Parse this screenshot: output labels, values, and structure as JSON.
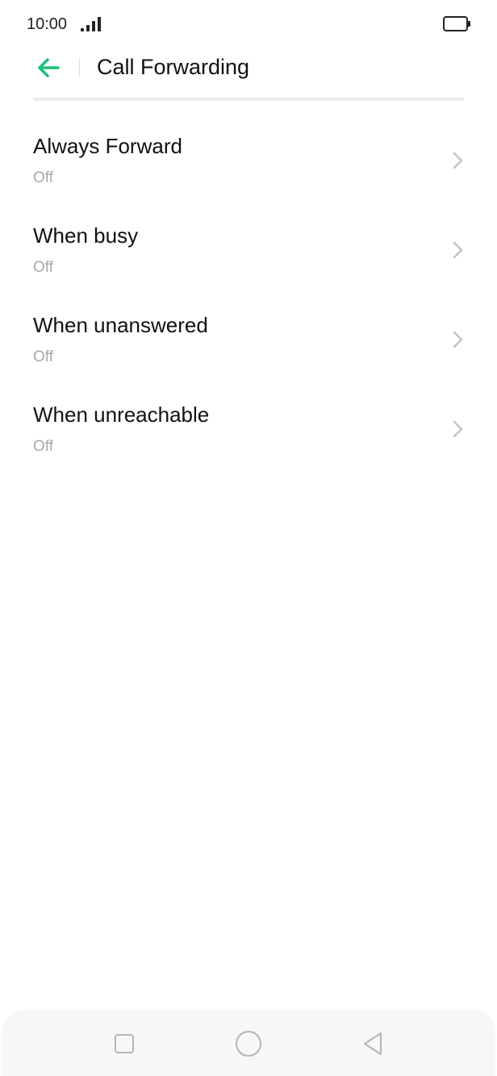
{
  "status_bar": {
    "time": "10:00",
    "signal_icon": "signal-bars-icon",
    "battery_icon": "battery-full-icon"
  },
  "header": {
    "back_icon": "arrow-left-icon",
    "title": "Call Forwarding"
  },
  "colors": {
    "accent": "#1fbf7a",
    "text_primary": "#111111",
    "text_secondary": "#a7a7a7",
    "nav_background": "#f7f7f7"
  },
  "items": [
    {
      "title": "Always Forward",
      "status": "Off"
    },
    {
      "title": "When busy",
      "status": "Off"
    },
    {
      "title": "When unanswered",
      "status": "Off"
    },
    {
      "title": "When unreachable",
      "status": "Off"
    }
  ],
  "nav_bar": {
    "recents_icon": "square-icon",
    "home_icon": "circle-icon",
    "back_icon": "triangle-back-icon"
  }
}
